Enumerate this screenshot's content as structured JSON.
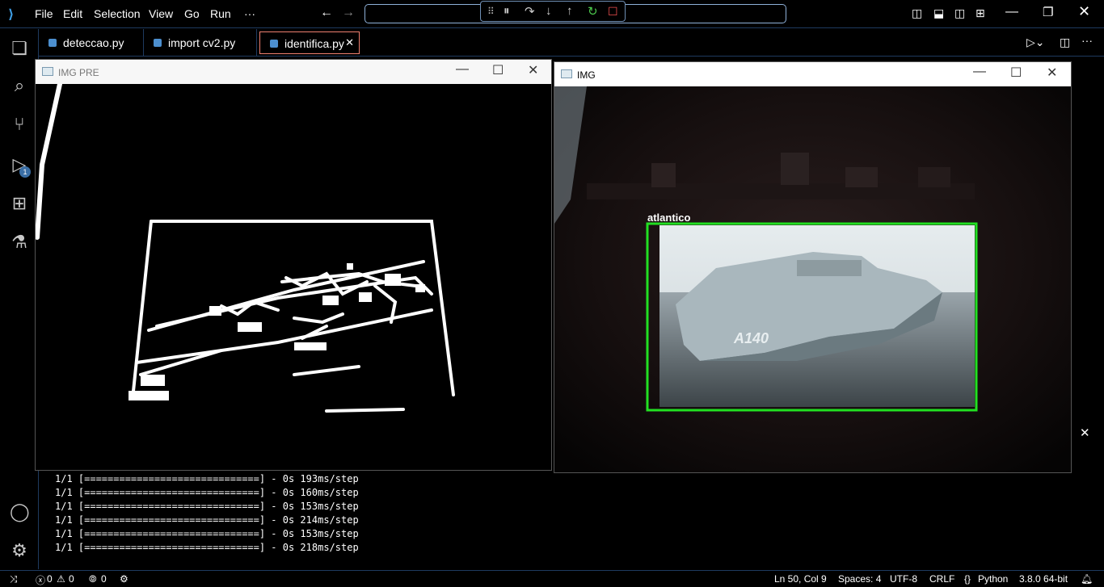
{
  "menu": [
    "File",
    "Edit",
    "Selection",
    "View",
    "Go",
    "Run"
  ],
  "menu_more": "···",
  "tabs": [
    {
      "label": "deteccao.py"
    },
    {
      "label": "import cv2.py"
    },
    {
      "label": "identifica.py"
    }
  ],
  "activity_badge": "1",
  "windows": {
    "pre": {
      "title": "IMG PRE"
    },
    "img": {
      "title": "IMG",
      "label": "atlantico",
      "ship_text": "A140"
    }
  },
  "terminal_lines": [
    "1/1 [==============================] - 0s 193ms/step",
    "1/1 [==============================] - 0s 160ms/step",
    "1/1 [==============================] - 0s 153ms/step",
    "1/1 [==============================] - 0s 214ms/step",
    "1/1 [==============================] - 0s 153ms/step",
    "1/1 [==============================] - 0s 218ms/step"
  ],
  "status": {
    "errors": "0",
    "warnings": "0",
    "ports": "0",
    "position": "Ln 50, Col 9",
    "spaces": "Spaces: 4",
    "encoding": "UTF-8",
    "eol": "CRLF",
    "language": "Python",
    "interpreter": "3.8.0 64-bit"
  },
  "colors": {
    "accent": "#1e3a5f",
    "detection_box": "#22e022",
    "tab_active_border": "#f08070"
  }
}
